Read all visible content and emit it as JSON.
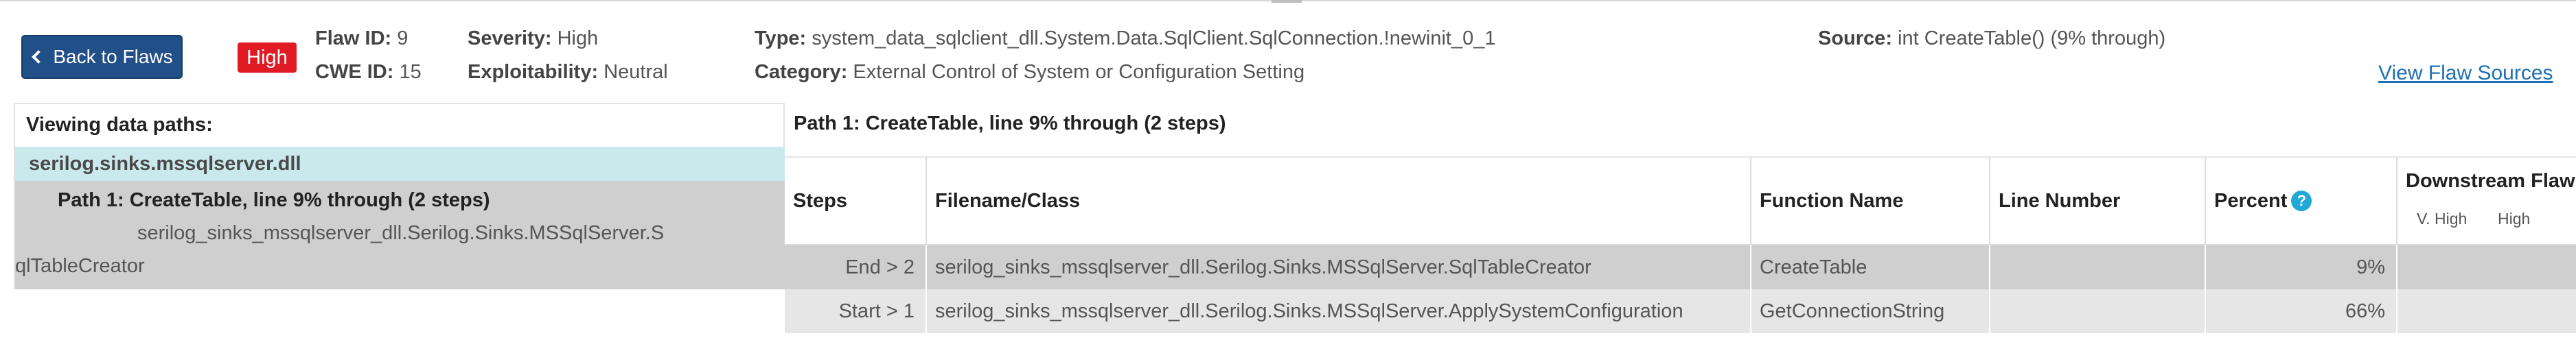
{
  "header": {
    "back_label": "Back to Flaws",
    "severity_badge": "High",
    "flaw_id_label": "Flaw ID:",
    "flaw_id": "9",
    "cwe_id_label": "CWE ID:",
    "cwe_id": "15",
    "severity_label": "Severity:",
    "severity": "High",
    "exploitability_label": "Exploitability:",
    "exploitability": "Neutral",
    "type_label": "Type:",
    "type": "system_data_sqlclient_dll.System.Data.SqlClient.SqlConnection.!newinit_0_1",
    "category_label": "Category:",
    "category": "External Control of System or Configuration Setting",
    "source_label": "Source:",
    "source": "int CreateTable() (9% through)",
    "view_sources_label": "View Flaw Sources"
  },
  "left": {
    "title": "Viewing data paths:",
    "assembly": "serilog.sinks.mssqlserver.dll",
    "path_label": "Path 1: CreateTable, line 9% through (2 steps)",
    "class_line1": "serilog_sinks_mssqlserver_dll.Serilog.Sinks.MSSqlServer.S",
    "class_line2": "qlTableCreator"
  },
  "right": {
    "title": "Path 1: CreateTable, line 9% through (2 steps)",
    "columns": {
      "steps": "Steps",
      "filename": "Filename/Class",
      "function": "Function Name",
      "line": "Line Number",
      "percent": "Percent",
      "help": "?",
      "downstream": "Downstream Flaw",
      "v_high": "V. High",
      "high": "High"
    },
    "rows": [
      {
        "steps": "End > 2",
        "filename": "serilog_sinks_mssqlserver_dll.Serilog.Sinks.MSSqlServer.SqlTableCreator",
        "function": "CreateTable",
        "line": "",
        "percent": "9%"
      },
      {
        "steps": "Start > 1",
        "filename": "serilog_sinks_mssqlserver_dll.Serilog.Sinks.MSSqlServer.ApplySystemConfiguration",
        "function": "GetConnectionString",
        "line": "",
        "percent": "66%"
      }
    ]
  },
  "colors": {
    "primary_button": "#214f87",
    "high_badge": "#e01b24",
    "assembly_highlight": "#c9e9ed",
    "selected_row": "#cfcfcf",
    "link": "#1f6fb5",
    "help_icon": "#20a8d8"
  },
  "icons": {
    "back": "chevron-left-icon",
    "help": "question-circle-icon"
  }
}
